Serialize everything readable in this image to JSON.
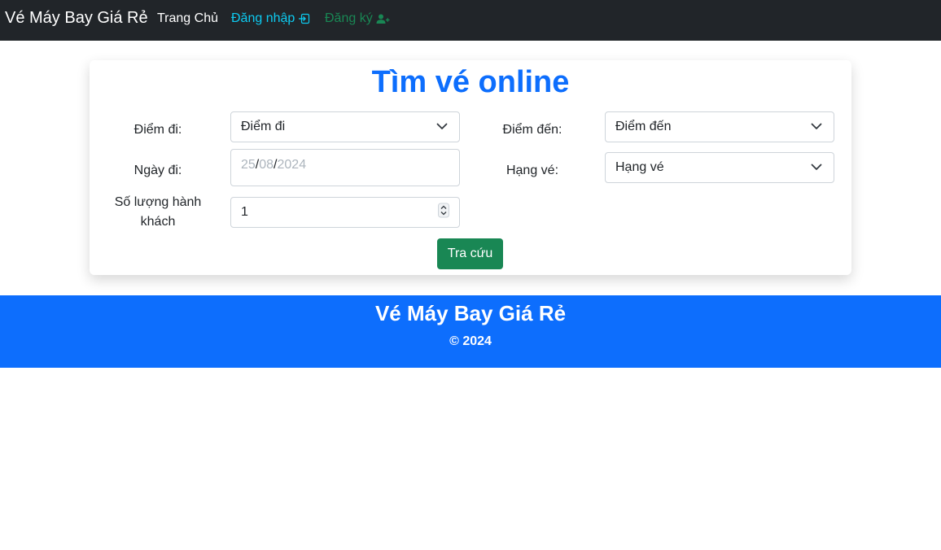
{
  "navbar": {
    "brand": "Vé Máy Bay Giá Rẻ",
    "home": "Trang Chủ",
    "login": "Đăng nhập",
    "register": "Đăng ký",
    "login_icon": "sign-in-icon",
    "register_icon": "user-plus-icon",
    "colors": {
      "background": "#212529",
      "login": "#0dcaf0",
      "register": "#198754"
    }
  },
  "search": {
    "title": "Tìm vé online",
    "origin_label": "Điểm đi:",
    "origin_value": "Điểm đi",
    "destination_label": "Điểm đến:",
    "destination_value": "Điểm đến",
    "date_label": "Ngày đi:",
    "date_day": "25",
    "date_month": "08",
    "date_year": "2024",
    "date_sep": "/",
    "class_label": "Hạng vé:",
    "class_value": "Hạng vé",
    "passengers_label": "Số lượng hành khách",
    "passengers_value": "1",
    "button": "Tra cứu"
  },
  "footer": {
    "title": "Vé Máy Bay Giá Rẻ",
    "copyright": "© 2024",
    "background": "#0d6efd"
  }
}
